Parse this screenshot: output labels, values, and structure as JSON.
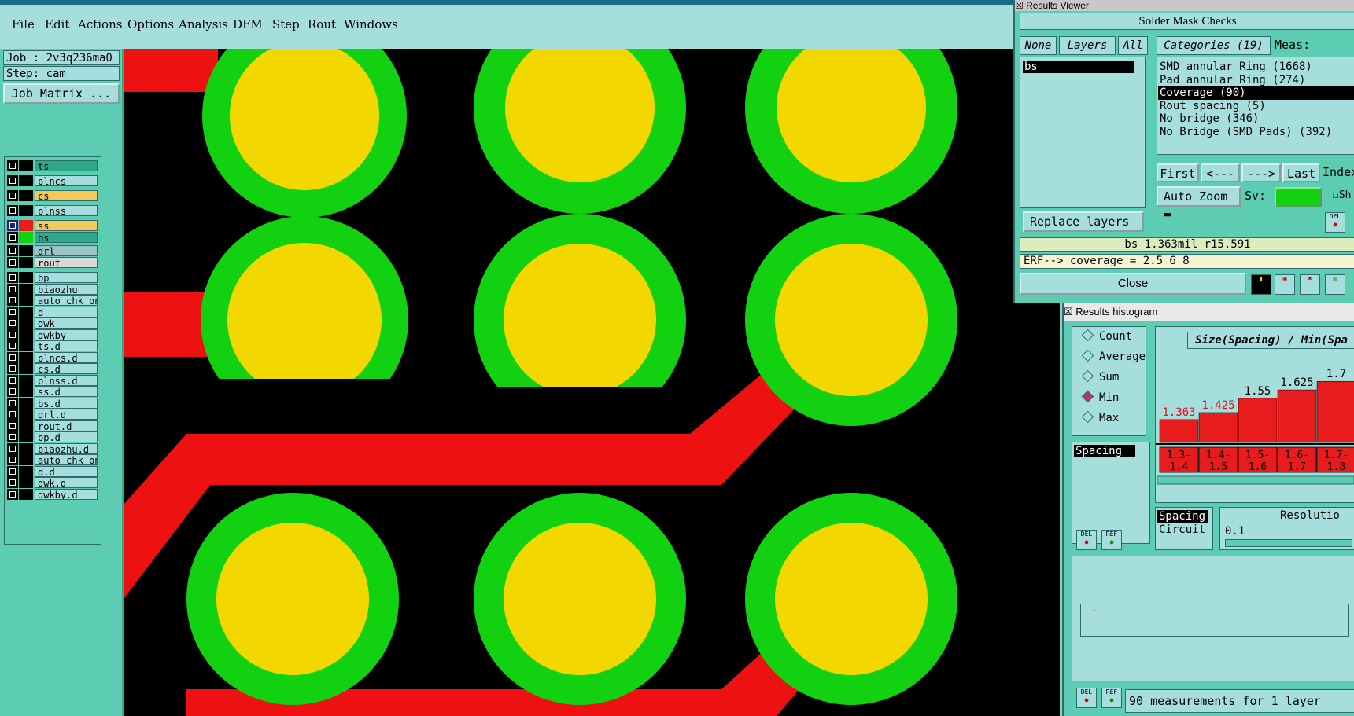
{
  "menubar": {
    "items": [
      "File",
      "Edit",
      "Actions",
      "Options",
      "Analysis",
      "DFM",
      "Step",
      "Rout",
      "Windows"
    ]
  },
  "job": {
    "label": "Job : 2v3q236ma0",
    "step": "Step: cam",
    "matrix_button": "Job Matrix ..."
  },
  "layers": [
    {
      "name": "ts",
      "color": "#2eaa8a"
    },
    {
      "name": "plncs",
      "color": "#a6dede"
    },
    {
      "name": "cs",
      "color": "#f5c85a"
    },
    {
      "name": "plnss",
      "color": "#a6dede"
    },
    {
      "name": "ss",
      "color": "#f5c85a"
    },
    {
      "name": "bs",
      "color": "#2eaa8a"
    },
    {
      "name": "drl",
      "color": "#9ec3c6"
    },
    {
      "name": "rout",
      "color": "#d8d8d8"
    },
    {
      "name": "bp",
      "color": "#a6dede"
    },
    {
      "name": "biaozhu",
      "color": "#a6dede"
    },
    {
      "name": "auto_chk_pn",
      "color": "#a6dede"
    },
    {
      "name": "d",
      "color": "#a6dede"
    },
    {
      "name": "dwk",
      "color": "#a6dede"
    },
    {
      "name": "dwkby",
      "color": "#a6dede"
    },
    {
      "name": "ts.d",
      "color": "#a6dede"
    },
    {
      "name": "plncs.d",
      "color": "#a6dede"
    },
    {
      "name": "cs.d",
      "color": "#a6dede"
    },
    {
      "name": "plnss.d",
      "color": "#a6dede"
    },
    {
      "name": "ss.d",
      "color": "#a6dede"
    },
    {
      "name": "bs.d",
      "color": "#a6dede"
    },
    {
      "name": "drl.d",
      "color": "#a6dede"
    },
    {
      "name": "rout.d",
      "color": "#a6dede"
    },
    {
      "name": "bp.d",
      "color": "#a6dede"
    },
    {
      "name": "biaozhu.d",
      "color": "#a6dede"
    },
    {
      "name": "auto_chk_pn",
      "color": "#a6dede"
    },
    {
      "name": "d.d",
      "color": "#a6dede"
    },
    {
      "name": "dwk.d",
      "color": "#a6dede"
    },
    {
      "name": "dwkby.d",
      "color": "#a6dede"
    }
  ],
  "results_viewer": {
    "title": "Results Viewer",
    "header": "Solder Mask Checks",
    "none_btn": "None",
    "layers_btn": "Layers",
    "all_btn": "All",
    "categories_header": "Categories (19)",
    "meas_label": "Meas:",
    "layer_list": [
      "bs"
    ],
    "categories": [
      "SMD annular Ring (1668)",
      "Pad annular Ring (274)",
      "Coverage (90)",
      "Rout spacing (5)",
      "No bridge (346)",
      "No Bridge (SMD Pads) (392)"
    ],
    "selected_category": "Coverage (90)",
    "first_btn": "First",
    "prev_btn": "<---",
    "next_btn": "--->",
    "last_btn": "Last",
    "index_label": "Index:",
    "auto_zoom": "Auto Zoom",
    "sv_label": "Sv:",
    "sh_label": "Sh",
    "replace_layers": "Replace layers",
    "measurement": "bs 1.363mil  r15.591",
    "erf": "ERF--> coverage = 2.5 6 8",
    "close_btn": "Close"
  },
  "histogram": {
    "title": "Results histogram",
    "modes": [
      "Count",
      "Average",
      "Sum",
      "Min",
      "Max"
    ],
    "selected_mode": "Min",
    "chart_title": "Size(Spacing) / Min(Spa",
    "left_list": [
      "Spacing"
    ],
    "bottom_list": [
      "Spacing",
      "Circuit"
    ],
    "resolution_label": "Resolutio",
    "resolution_value": "0.1",
    "status": "90 measurements for 1 layer",
    "del_label": "DEL",
    "ref_label": "REF"
  },
  "chart_data": {
    "type": "bar",
    "title": "Size(Spacing) / Min(Spa",
    "categories": [
      "1.3-1.4",
      "1.4-1.5",
      "1.5-1.6",
      "1.6-1.7",
      "1.7-1.8"
    ],
    "values": [
      1.363,
      1.425,
      1.55,
      1.625,
      1.7
    ],
    "value_labels": [
      "1.363",
      "1.425",
      "1.55",
      "1.625",
      "1.7"
    ],
    "highlight_color": "#e0101a",
    "bar_color": "#e81c1c"
  },
  "colors": {
    "panel": "#5ccdb2",
    "widget": "#a6dede",
    "pad_outer": "#11d111",
    "pad_inner": "#f2d800",
    "trace": "#ee1111",
    "canvas": "#000000"
  }
}
